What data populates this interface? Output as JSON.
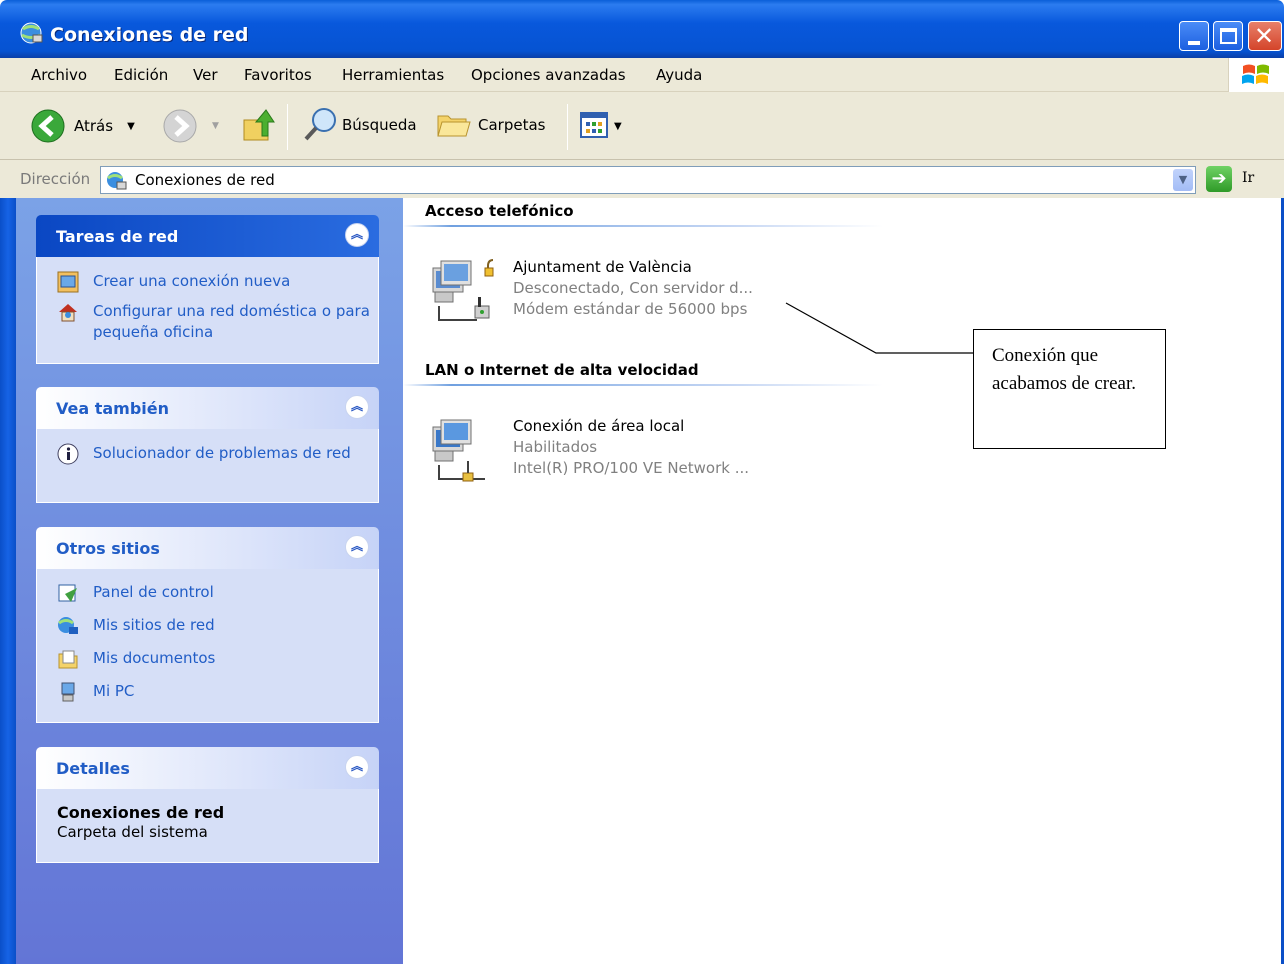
{
  "window": {
    "title": "Conexiones de red"
  },
  "menu": [
    "Archivo",
    "Edición",
    "Ver",
    "Favoritos",
    "Herramientas",
    "Opciones avanzadas",
    "Ayuda"
  ],
  "toolbar": {
    "back": "Atrás",
    "search": "Búsqueda",
    "folders": "Carpetas"
  },
  "address": {
    "label": "Dirección",
    "value": "Conexiones de red",
    "go": "Ir"
  },
  "tasks": {
    "network": {
      "title": "Tareas de red",
      "items": [
        "Crear una conexión nueva",
        "Configurar una red doméstica o para pequeña oficina"
      ]
    },
    "see_also": {
      "title": "Vea también",
      "items": [
        "Solucionador de problemas de red"
      ]
    },
    "other_places": {
      "title": "Otros sitios",
      "items": [
        "Panel de control",
        "Mis sitios de red",
        "Mis documentos",
        "Mi PC"
      ]
    },
    "details": {
      "title": "Detalles",
      "name": "Conexiones de red",
      "type": "Carpeta del sistema"
    }
  },
  "groups": [
    {
      "title": "Acceso telefónico",
      "item": {
        "name": "Ajuntament de València",
        "status": "Desconectado, Con servidor d...",
        "device": "Módem estándar de 56000 bps"
      }
    },
    {
      "title": "LAN o Internet de alta velocidad",
      "item": {
        "name": "Conexión de área local",
        "status": "Habilitados",
        "device": "Intel(R) PRO/100 VE Network ..."
      }
    }
  ],
  "callout": "Conexión que acabamos de crear."
}
